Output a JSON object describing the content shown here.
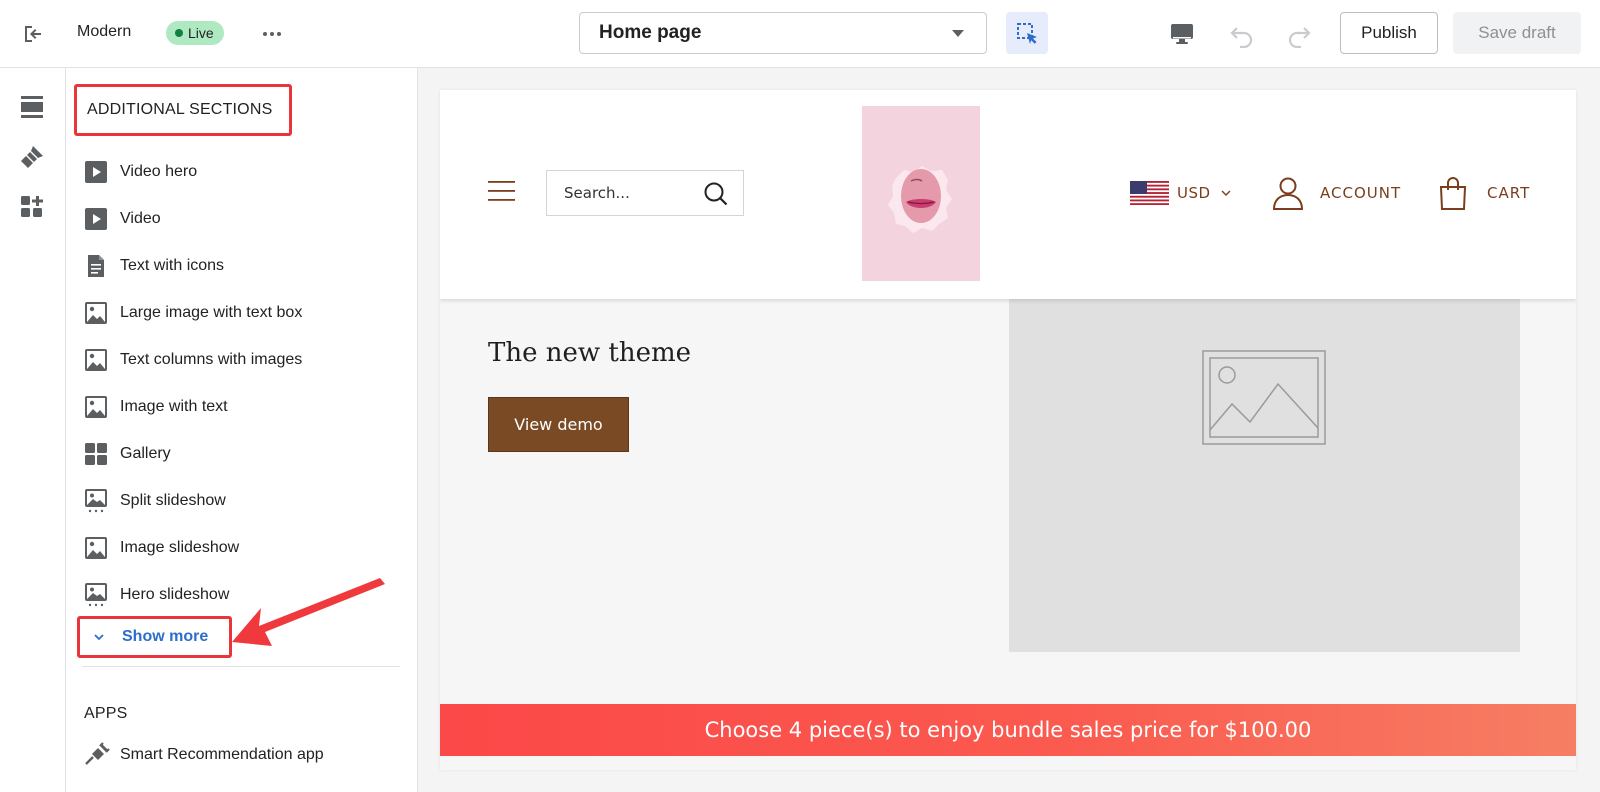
{
  "topbar": {
    "theme_name": "Modern",
    "status_badge": "Live",
    "page_select": "Home page",
    "publish_label": "Publish",
    "save_draft_label": "Save draft"
  },
  "rail": {
    "icons": [
      "sections-icon",
      "theme-settings-icon",
      "app-embeds-icon"
    ]
  },
  "sections_panel": {
    "heading": "ADDITIONAL SECTIONS",
    "items": [
      {
        "label": "Video hero",
        "icon": "video-icon"
      },
      {
        "label": "Video",
        "icon": "video-icon"
      },
      {
        "label": "Text with icons",
        "icon": "text-document-icon"
      },
      {
        "label": "Large image with text box",
        "icon": "image-icon"
      },
      {
        "label": "Text columns with images",
        "icon": "image-icon"
      },
      {
        "label": "Image with text",
        "icon": "image-icon"
      },
      {
        "label": "Gallery",
        "icon": "gallery-grid-icon"
      },
      {
        "label": "Split slideshow",
        "icon": "slideshow-icon"
      },
      {
        "label": "Image slideshow",
        "icon": "image-icon"
      },
      {
        "label": "Hero slideshow",
        "icon": "slideshow-icon"
      }
    ],
    "show_more": "Show more",
    "apps_heading": "APPS",
    "apps": [
      {
        "label": "Smart Recommendation app",
        "icon": "plug-icon"
      }
    ]
  },
  "storefront": {
    "search_placeholder": "Search...",
    "currency": "USD",
    "account_label": "ACCOUNT",
    "cart_label": "CART",
    "hero_title": "The new theme",
    "hero_button": "View demo",
    "announcement": "Choose 4 piece(s) to enjoy bundle sales price for $100.00"
  },
  "colors": {
    "accent_blue": "#2c6ecb",
    "annotation_red": "#e8353a",
    "live_badge": "#aee9c1",
    "brand_brown": "#7a4a24",
    "announcement_bar": "#fb4848"
  }
}
